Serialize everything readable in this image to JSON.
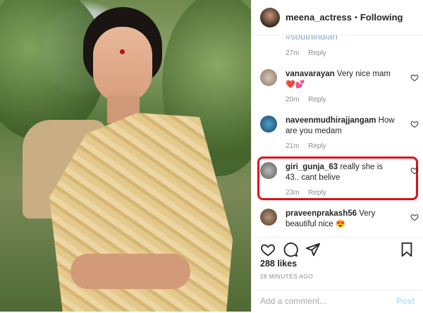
{
  "header": {
    "username": "meena_actress",
    "separator": "•",
    "follow_status": "Following"
  },
  "comments": {
    "partial_top": {
      "text": "#southindian",
      "time": "27m",
      "reply": "Reply"
    },
    "items": [
      {
        "user": "vanavarayan",
        "text": "Very nice mam",
        "extra": "❤️💕",
        "time": "20m",
        "reply": "Reply"
      },
      {
        "user": "naveenmudhirajjangam",
        "text": "How are you medam",
        "extra": "",
        "time": "21m",
        "reply": "Reply"
      },
      {
        "user": "giri_gunja_63",
        "text": "really she is 43.. cant belive",
        "extra": "",
        "time": "23m",
        "reply": "Reply"
      },
      {
        "user": "praveenprakash56",
        "text": "Very beautiful nice",
        "extra": "😍",
        "time": "",
        "reply": ""
      }
    ]
  },
  "actions": {
    "likes": "288 likes",
    "timestamp": "28 MINUTES AGO"
  },
  "add_comment": {
    "placeholder": "Add a comment...",
    "post_label": "Post"
  },
  "colors": {
    "highlight": "#e0101a",
    "link": "#8aa5c7",
    "post_disabled": "#b2dffc"
  }
}
